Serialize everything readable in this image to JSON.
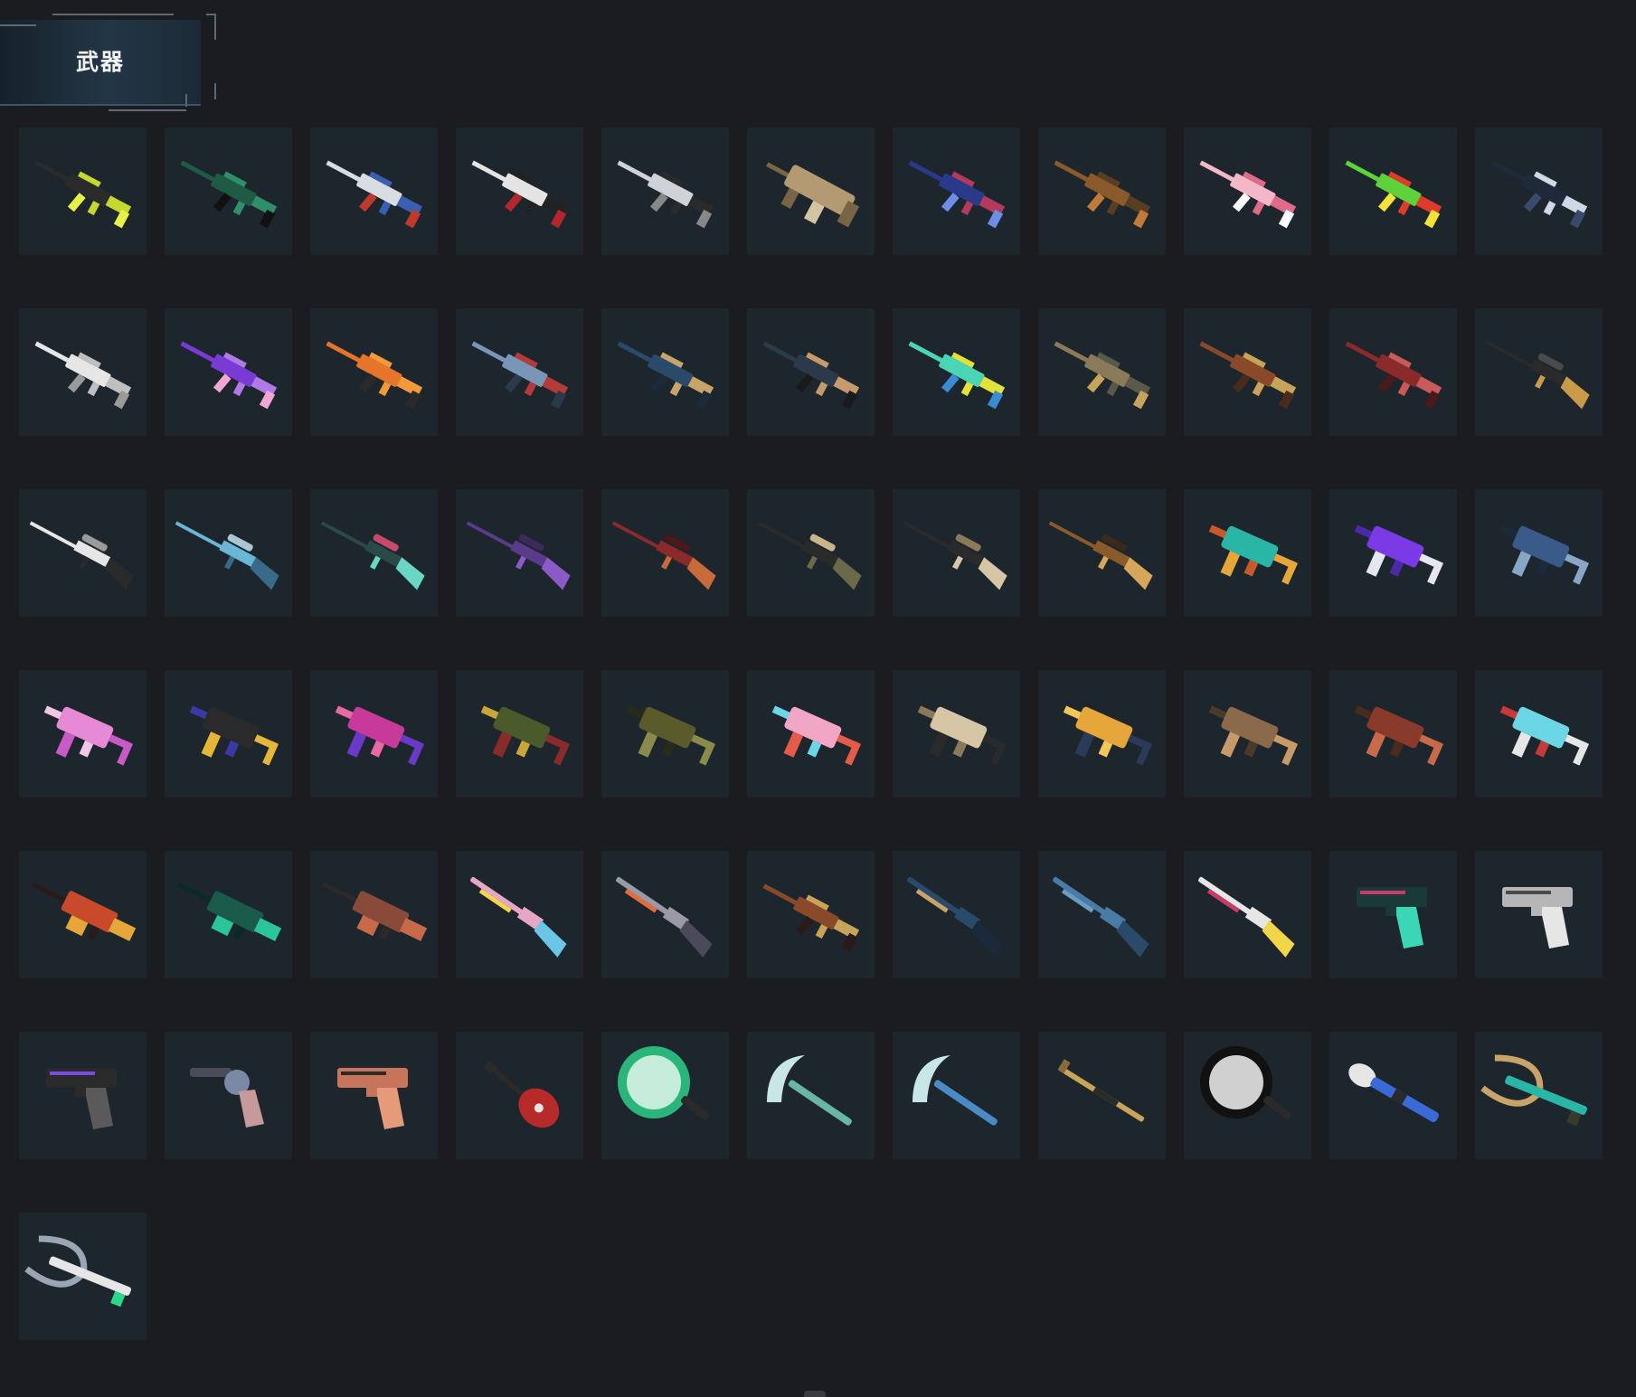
{
  "header": {
    "title": "武器"
  },
  "colors": {
    "background": "#1b1c1f",
    "tile_background": "#1d252d",
    "header_panel": "#233646"
  },
  "weapons": [
    {
      "icon": "assault-rifle-icon",
      "colors": [
        "#2b2b2b",
        "#c4d82e",
        "#e8f04a"
      ]
    },
    {
      "icon": "assault-rifle-icon",
      "colors": [
        "#1f5a45",
        "#2f8f6a",
        "#111111"
      ]
    },
    {
      "icon": "assault-rifle-icon",
      "colors": [
        "#d9dde2",
        "#3a5fb0",
        "#c0392b"
      ]
    },
    {
      "icon": "assault-rifle-icon",
      "colors": [
        "#e4e4e4",
        "#222222",
        "#b3262e"
      ]
    },
    {
      "icon": "assault-rifle-icon",
      "colors": [
        "#cfd3d8",
        "#2a2a2a",
        "#888888"
      ]
    },
    {
      "icon": "bullpup-rifle-icon",
      "colors": [
        "#b49a72",
        "#7a6446",
        "#d5c4a2"
      ]
    },
    {
      "icon": "assault-rifle-icon",
      "colors": [
        "#2a3a8a",
        "#b23a5e",
        "#6c8ee6"
      ]
    },
    {
      "icon": "assault-rifle-icon",
      "colors": [
        "#8a5a2a",
        "#5a3e22",
        "#c27a3a"
      ]
    },
    {
      "icon": "assault-rifle-icon",
      "colors": [
        "#f2b8c8",
        "#e06a8a",
        "#fafafa"
      ]
    },
    {
      "icon": "assault-rifle-icon",
      "colors": [
        "#5fd13a",
        "#e23a2a",
        "#f2e23a"
      ]
    },
    {
      "icon": "assault-rifle-icon",
      "colors": [
        "#1e2a3a",
        "#cfd8e6",
        "#3a4a6a"
      ]
    },
    {
      "icon": "assault-rifle-icon",
      "colors": [
        "#e6e6e6",
        "#bfbfbf",
        "#9a9a9a"
      ]
    },
    {
      "icon": "assault-rifle-icon",
      "colors": [
        "#7a3ad6",
        "#b07ae6",
        "#f2a6d6"
      ]
    },
    {
      "icon": "assault-rifle-icon",
      "colors": [
        "#e6742a",
        "#f29a3a",
        "#2a2a2a"
      ]
    },
    {
      "icon": "assault-rifle-icon",
      "colors": [
        "#7a96b6",
        "#b63a3a",
        "#2a3a4a"
      ]
    },
    {
      "icon": "assault-rifle-icon",
      "colors": [
        "#2a4a6a",
        "#c8a46a",
        "#1a2a3a"
      ]
    },
    {
      "icon": "assault-rifle-icon",
      "colors": [
        "#2a3a4a",
        "#c69a6a",
        "#1a1a1a"
      ]
    },
    {
      "icon": "assault-rifle-icon",
      "colors": [
        "#4ad6b6",
        "#e2e23a",
        "#3a8ad6"
      ]
    },
    {
      "icon": "assault-rifle-icon",
      "colors": [
        "#8a7a5a",
        "#5a5a4a",
        "#c8a45a"
      ]
    },
    {
      "icon": "assault-rifle-icon",
      "colors": [
        "#8a4a2a",
        "#c8a45a",
        "#4a2a1a"
      ]
    },
    {
      "icon": "assault-rifle-icon",
      "colors": [
        "#8a2a2a",
        "#c85a5a",
        "#4a1a1a"
      ]
    },
    {
      "icon": "sniper-rifle-icon",
      "colors": [
        "#2a2a2a",
        "#c89a4a",
        "#4a4a4a"
      ]
    },
    {
      "icon": "sniper-rifle-icon",
      "colors": [
        "#e6e6e6",
        "#2a2a2a",
        "#9a9a9a"
      ]
    },
    {
      "icon": "sniper-rifle-icon",
      "colors": [
        "#6ab6d6",
        "#3a6a8a",
        "#aac6d6"
      ]
    },
    {
      "icon": "sniper-rifle-icon",
      "colors": [
        "#2a4a4a",
        "#6ad6c6",
        "#c84a6a"
      ]
    },
    {
      "icon": "sniper-rifle-icon",
      "colors": [
        "#5a3a8a",
        "#8a5ac6",
        "#3a2a5a"
      ]
    },
    {
      "icon": "sniper-rifle-icon",
      "colors": [
        "#8a2a2a",
        "#c86a3a",
        "#4a1a1a"
      ]
    },
    {
      "icon": "sniper-rifle-icon",
      "colors": [
        "#2a2a2a",
        "#6a6a4a",
        "#c8b68a"
      ]
    },
    {
      "icon": "sniper-rifle-icon",
      "colors": [
        "#2a2a2a",
        "#d6c6a6",
        "#8a7a5a"
      ]
    },
    {
      "icon": "sniper-rifle-icon",
      "colors": [
        "#8a5a2a",
        "#d6a65a",
        "#3a2a1a"
      ]
    },
    {
      "icon": "submachine-gun-icon",
      "colors": [
        "#2ab6a6",
        "#e6a63a",
        "#c85a2a"
      ]
    },
    {
      "icon": "submachine-gun-icon",
      "colors": [
        "#7a3ae6",
        "#e6e6f2",
        "#4a2aa6"
      ]
    },
    {
      "icon": "submachine-gun-icon",
      "colors": [
        "#3a5a8a",
        "#8aa6c6",
        "#1a2a3a"
      ]
    },
    {
      "icon": "submachine-gun-icon",
      "colors": [
        "#e68ad6",
        "#c85ac6",
        "#f2c6e6"
      ]
    },
    {
      "icon": "submachine-gun-icon",
      "colors": [
        "#2a2a2a",
        "#e6b63a",
        "#3a3aa6"
      ]
    },
    {
      "icon": "submachine-gun-icon",
      "colors": [
        "#c83a9a",
        "#6a3ac6",
        "#e66aa6"
      ]
    },
    {
      "icon": "submachine-gun-icon",
      "colors": [
        "#4a5a2a",
        "#8a2a2a",
        "#c8a63a"
      ]
    },
    {
      "icon": "submachine-gun-icon",
      "colors": [
        "#5a5a2a",
        "#8a8a4a",
        "#2a2a1a"
      ]
    },
    {
      "icon": "submachine-gun-icon",
      "colors": [
        "#f2a6c6",
        "#e65a4a",
        "#6ad6e6"
      ]
    },
    {
      "icon": "submachine-gun-icon",
      "colors": [
        "#d6c6a6",
        "#2a2a2a",
        "#8a7a5a"
      ]
    },
    {
      "icon": "submachine-gun-icon",
      "colors": [
        "#e6a63a",
        "#2a3a5a",
        "#f2c65a"
      ]
    },
    {
      "icon": "submachine-gun-icon",
      "colors": [
        "#8a6a4a",
        "#c89a6a",
        "#4a3a2a"
      ]
    },
    {
      "icon": "submachine-gun-icon",
      "colors": [
        "#8a3a2a",
        "#c86a4a",
        "#4a2a1a"
      ]
    },
    {
      "icon": "submachine-gun-icon",
      "colors": [
        "#6ad6e6",
        "#e6e6e6",
        "#c83a3a"
      ]
    },
    {
      "icon": "machine-gun-icon",
      "colors": [
        "#c84a2a",
        "#e6a63a",
        "#2a1a1a"
      ]
    },
    {
      "icon": "machine-gun-icon",
      "colors": [
        "#1a5a4a",
        "#2ac69a",
        "#0a2a2a"
      ]
    },
    {
      "icon": "machine-gun-icon",
      "colors": [
        "#8a4a3a",
        "#c86a4a",
        "#2a2a2a"
      ]
    },
    {
      "icon": "shotgun-icon",
      "colors": [
        "#e6a6c6",
        "#f2d64a",
        "#6ac6e6"
      ]
    },
    {
      "icon": "shotgun-icon",
      "colors": [
        "#9a9aa6",
        "#e66a3a",
        "#4a4a5a"
      ]
    },
    {
      "icon": "assault-rifle-icon",
      "colors": [
        "#8a4a2a",
        "#c8a45a",
        "#2a1a1a"
      ]
    },
    {
      "icon": "shotgun-icon",
      "colors": [
        "#2a4a6a",
        "#c8a46a",
        "#1a2a3a"
      ]
    },
    {
      "icon": "shotgun-icon",
      "colors": [
        "#4a7aa6",
        "#6a9ac6",
        "#2a4a6a"
      ]
    },
    {
      "icon": "shotgun-icon",
      "colors": [
        "#e6e6e6",
        "#c83a6a",
        "#f2d64a"
      ]
    },
    {
      "icon": "pistol-icon",
      "colors": [
        "#1a3a3a",
        "#c83a6a",
        "#3ad6b6"
      ]
    },
    {
      "icon": "pistol-icon",
      "colors": [
        "#b6b6b6",
        "#4a4a4a",
        "#e6e6e6"
      ]
    },
    {
      "icon": "pistol-icon",
      "colors": [
        "#2a2a2a",
        "#7a4ae6",
        "#5a5a5a"
      ]
    },
    {
      "icon": "revolver-icon",
      "colors": [
        "#7a8aa6",
        "#c69a9a",
        "#4a4a5a"
      ]
    },
    {
      "icon": "pistol-icon",
      "colors": [
        "#c8745a",
        "#2a2a2a",
        "#e69a7a"
      ]
    },
    {
      "icon": "guitar-icon",
      "colors": [
        "#b62a2a",
        "#e6e6e6",
        "#2a2a2a"
      ]
    },
    {
      "icon": "frying-pan-icon",
      "colors": [
        "#2ab67a",
        "#d6f2e6",
        "#2a2a2a"
      ]
    },
    {
      "icon": "sickle-icon",
      "colors": [
        "#2a2a2a",
        "#6ab6a6",
        "#c8e6e6"
      ]
    },
    {
      "icon": "sickle-icon",
      "colors": [
        "#2a2a2a",
        "#4a8ac6",
        "#c8e6e6"
      ]
    },
    {
      "icon": "crowbar-icon",
      "colors": [
        "#c8a45a",
        "#2a2a2a",
        "#8a6a3a"
      ]
    },
    {
      "icon": "frying-pan-icon",
      "colors": [
        "#111111",
        "#e6e6e6",
        "#2a2a2a"
      ]
    },
    {
      "icon": "grenade-launcher-icon",
      "colors": [
        "#e6e6e6",
        "#3a6ad6",
        "#2a2a2a"
      ]
    },
    {
      "icon": "crossbow-icon",
      "colors": [
        "#c8a46a",
        "#2ab6a6",
        "#3a3a2a"
      ]
    },
    {
      "icon": "crossbow-icon",
      "colors": [
        "#9aa6b6",
        "#e6e6e6",
        "#2ad68a"
      ]
    }
  ]
}
